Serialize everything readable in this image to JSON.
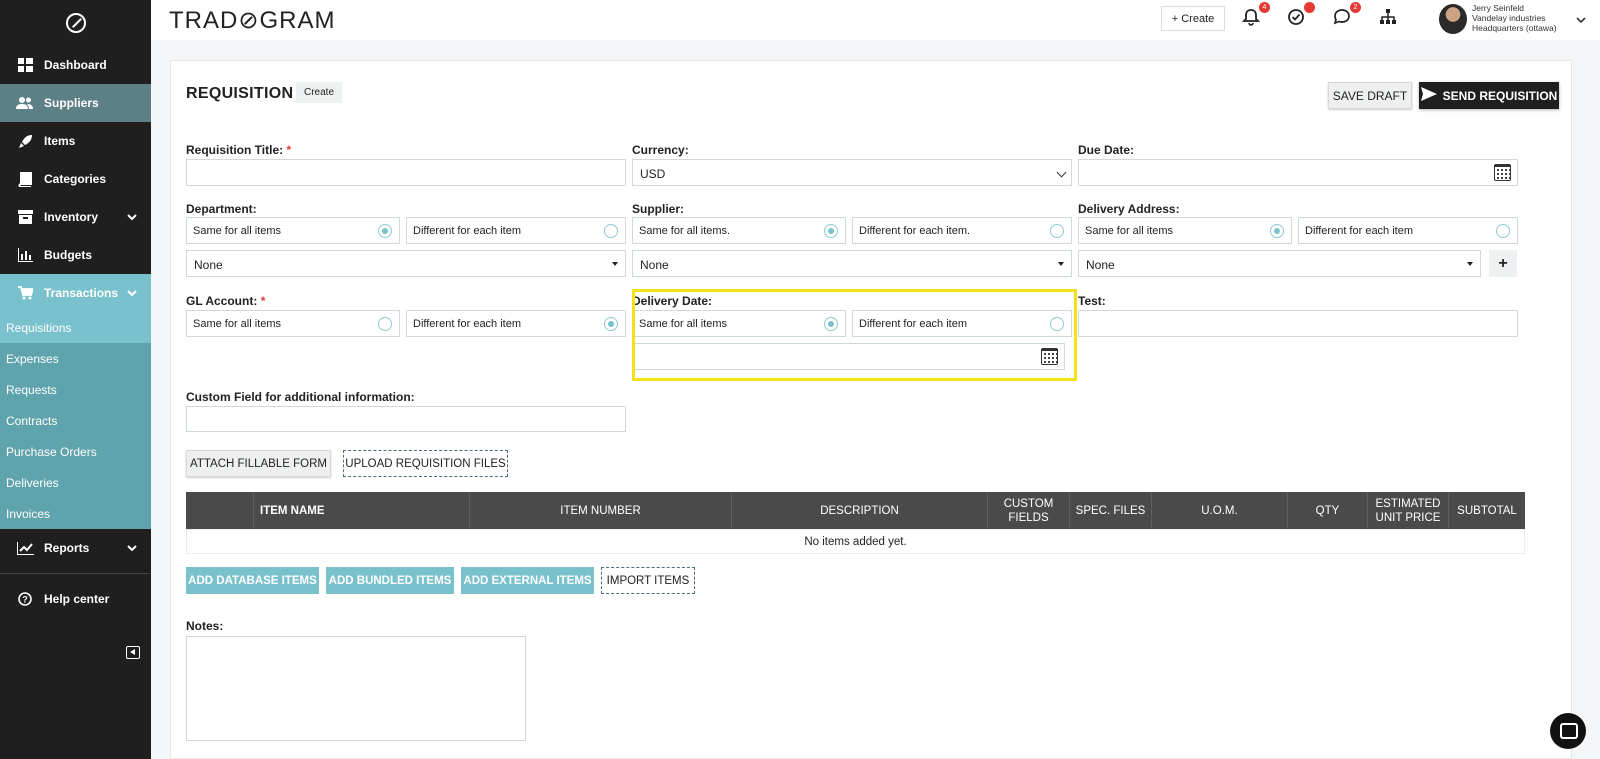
{
  "app": {
    "brand": "TRAD⊘GRAM"
  },
  "sidebar": {
    "items": [
      {
        "label": "Dashboard",
        "icon": "dashboard-icon"
      },
      {
        "label": "Suppliers",
        "icon": "users-icon"
      },
      {
        "label": "Items",
        "icon": "rocket-icon"
      },
      {
        "label": "Categories",
        "icon": "book-icon"
      },
      {
        "label": "Inventory",
        "icon": "box-icon"
      },
      {
        "label": "Budgets",
        "icon": "bar-chart-icon"
      },
      {
        "label": "Transactions",
        "icon": "cart-icon"
      }
    ],
    "transactions_sub": [
      "Requisitions",
      "Expenses",
      "Requests",
      "Contracts",
      "Purchase Orders",
      "Deliveries",
      "Invoices"
    ],
    "reports": "Reports",
    "help": "Help center"
  },
  "topbar": {
    "create": "+ Create",
    "notif_badges": {
      "bell": "4",
      "tasks": "",
      "chat": "2"
    },
    "user": {
      "name": "Jerry Seinfeld",
      "company": "Vandelay industries",
      "location": "Headquarters (ottawa)"
    }
  },
  "page": {
    "title": "REQUISITION",
    "mode": "Create",
    "save_draft": "SAVE DRAFT",
    "send": "SEND REQUISITION"
  },
  "form": {
    "req_title": {
      "label": "Requisition Title:",
      "required": "*",
      "value": ""
    },
    "currency": {
      "label": "Currency:",
      "value": "USD"
    },
    "due_date": {
      "label": "Due Date:",
      "value": ""
    },
    "department": {
      "label": "Department:",
      "same": "Same for all items",
      "diff": "Different for each item",
      "value": "None"
    },
    "supplier": {
      "label": "Supplier:",
      "same": "Same for all items.",
      "diff": "Different for each item.",
      "value": "None"
    },
    "delivery_address": {
      "label": "Delivery Address:",
      "same": "Same for all items",
      "diff": "Different for each item",
      "value": "None"
    },
    "gl_account": {
      "label": "GL Account:",
      "required": "*",
      "same": "Same for all items",
      "diff": "Different for each item"
    },
    "delivery_date": {
      "label": "Delivery Date:",
      "same": "Same for all items",
      "diff": "Different for each item"
    },
    "test": {
      "label": "Test:",
      "value": ""
    },
    "custom_field": {
      "label": "Custom Field for additional information:",
      "value": ""
    },
    "notes": {
      "label": "Notes:"
    }
  },
  "buttons": {
    "attach": "ATTACH FILLABLE FORM",
    "upload": "UPLOAD REQUISITION FILES",
    "add_db": "ADD DATABASE ITEMS",
    "add_bundled": "ADD BUNDLED ITEMS",
    "add_external": "ADD EXTERNAL ITEMS",
    "import": "IMPORT ITEMS"
  },
  "table": {
    "headers": [
      "",
      "ITEM NAME",
      "ITEM NUMBER",
      "DESCRIPTION",
      "CUSTOM FIELDS",
      "SPEC. FILES",
      "U.O.M.",
      "QTY",
      "ESTIMATED UNIT PRICE",
      "SUBTOTAL"
    ],
    "empty": "No items added yet."
  },
  "colors": {
    "accent": "#79c1cc",
    "sidebar": "#1f1f1f",
    "highlight": "#f3e316"
  }
}
